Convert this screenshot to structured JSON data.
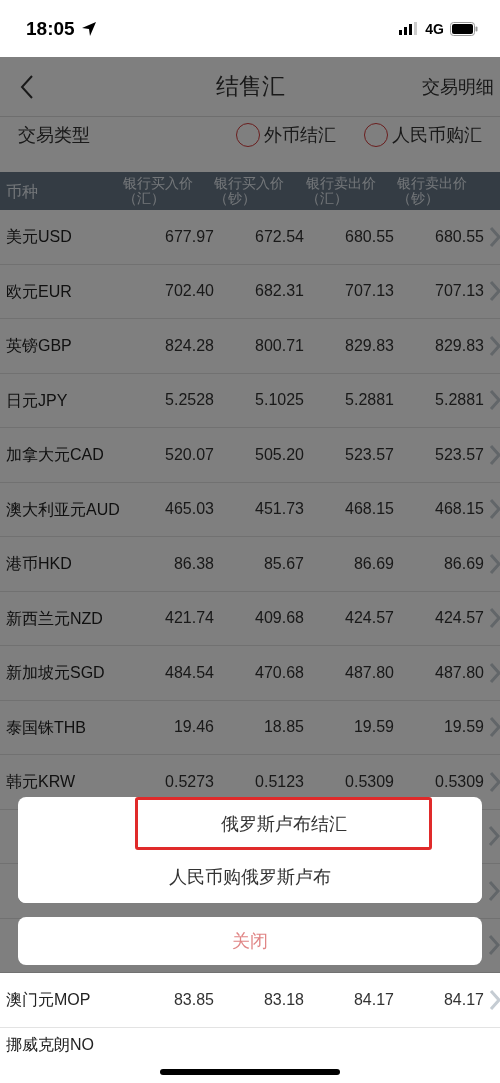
{
  "status_bar": {
    "time": "18:05",
    "network": "4G"
  },
  "nav": {
    "title": "结售汇",
    "action": "交易明细"
  },
  "trade_type": {
    "label": "交易类型",
    "options": [
      {
        "label": "外币结汇",
        "selected": false
      },
      {
        "label": "人民币购汇",
        "selected": false
      }
    ]
  },
  "table": {
    "columns": [
      "币种",
      "银行买入价（汇）",
      "银行买入价（钞）",
      "银行卖出价（汇）",
      "银行卖出价（钞）"
    ],
    "rows": [
      {
        "currency": "美元USD",
        "values": [
          "677.97",
          "672.54",
          "680.55",
          "680.55"
        ]
      },
      {
        "currency": "欧元EUR",
        "values": [
          "702.40",
          "682.31",
          "707.13",
          "707.13"
        ]
      },
      {
        "currency": "英镑GBP",
        "values": [
          "824.28",
          "800.71",
          "829.83",
          "829.83"
        ]
      },
      {
        "currency": "日元JPY",
        "values": [
          "5.2528",
          "5.1025",
          "5.2881",
          "5.2881"
        ]
      },
      {
        "currency": "加拿大元CAD",
        "values": [
          "520.07",
          "505.20",
          "523.57",
          "523.57"
        ]
      },
      {
        "currency": "澳大利亚元AUD",
        "values": [
          "465.03",
          "451.73",
          "468.15",
          "468.15"
        ]
      },
      {
        "currency": "港币HKD",
        "values": [
          "86.38",
          "85.67",
          "86.69",
          "86.69"
        ]
      },
      {
        "currency": "新西兰元NZD",
        "values": [
          "421.74",
          "409.68",
          "424.57",
          "424.57"
        ]
      },
      {
        "currency": "新加坡元SGD",
        "values": [
          "484.54",
          "470.68",
          "487.80",
          "487.80"
        ]
      },
      {
        "currency": "泰国铢THB",
        "values": [
          "19.46",
          "18.85",
          "19.59",
          "19.59"
        ]
      },
      {
        "currency": "韩元KRW",
        "values": [
          "0.5273",
          "0.5123",
          "0.5309",
          "0.5309"
        ]
      }
    ],
    "rows_below": [
      {
        "currency": "澳门元MOP",
        "values": [
          "83.85",
          "83.18",
          "84.17",
          "84.17"
        ]
      },
      {
        "currency": "挪威克朗NO"
      }
    ]
  },
  "action_sheet": {
    "options": [
      {
        "label": "俄罗斯卢布结汇",
        "highlighted": true
      },
      {
        "label": "人民币购俄罗斯卢布",
        "highlighted": false
      }
    ],
    "cancel": "关闭"
  }
}
